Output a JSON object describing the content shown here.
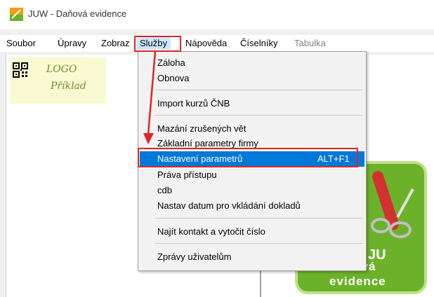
{
  "window": {
    "title": "JUW - Daňová evidence"
  },
  "menubar": {
    "items": [
      {
        "label": "Soubor",
        "disabled": false
      },
      {
        "label": "Úpravy",
        "disabled": false
      },
      {
        "label": "Zobraz",
        "disabled": false
      },
      {
        "label": "Služby",
        "disabled": false
      },
      {
        "label": "Nápověda",
        "disabled": false
      },
      {
        "label": "Číselníky",
        "disabled": false
      },
      {
        "label": "Tabulka",
        "disabled": true
      }
    ]
  },
  "logo": {
    "line1": "LOGO",
    "line2": "Příklad"
  },
  "dropdown": {
    "items": [
      {
        "label": "Záloha"
      },
      {
        "label": "Obnova"
      },
      {
        "label": "Import kurzů ČNB"
      },
      {
        "label": "Mazání zrušených vět"
      },
      {
        "label": "Základní parametry firmy"
      },
      {
        "label": "Nastavení parametrů",
        "shortcut": "ALT+F1",
        "selected": true
      },
      {
        "label": "Práva přístupu"
      },
      {
        "label": "cdb"
      },
      {
        "label": "Nastav datum pro vkládání dokladů"
      },
      {
        "label": "Najít kontakt a vytočit číslo"
      },
      {
        "label": "Zprávy uživatelům"
      }
    ]
  },
  "badge": {
    "line1": "JU",
    "line2": "Daňová",
    "line3": "evidence"
  },
  "colors": {
    "highlight": "#e02424",
    "selection": "#0078d7",
    "badge": "#6bb22a"
  }
}
